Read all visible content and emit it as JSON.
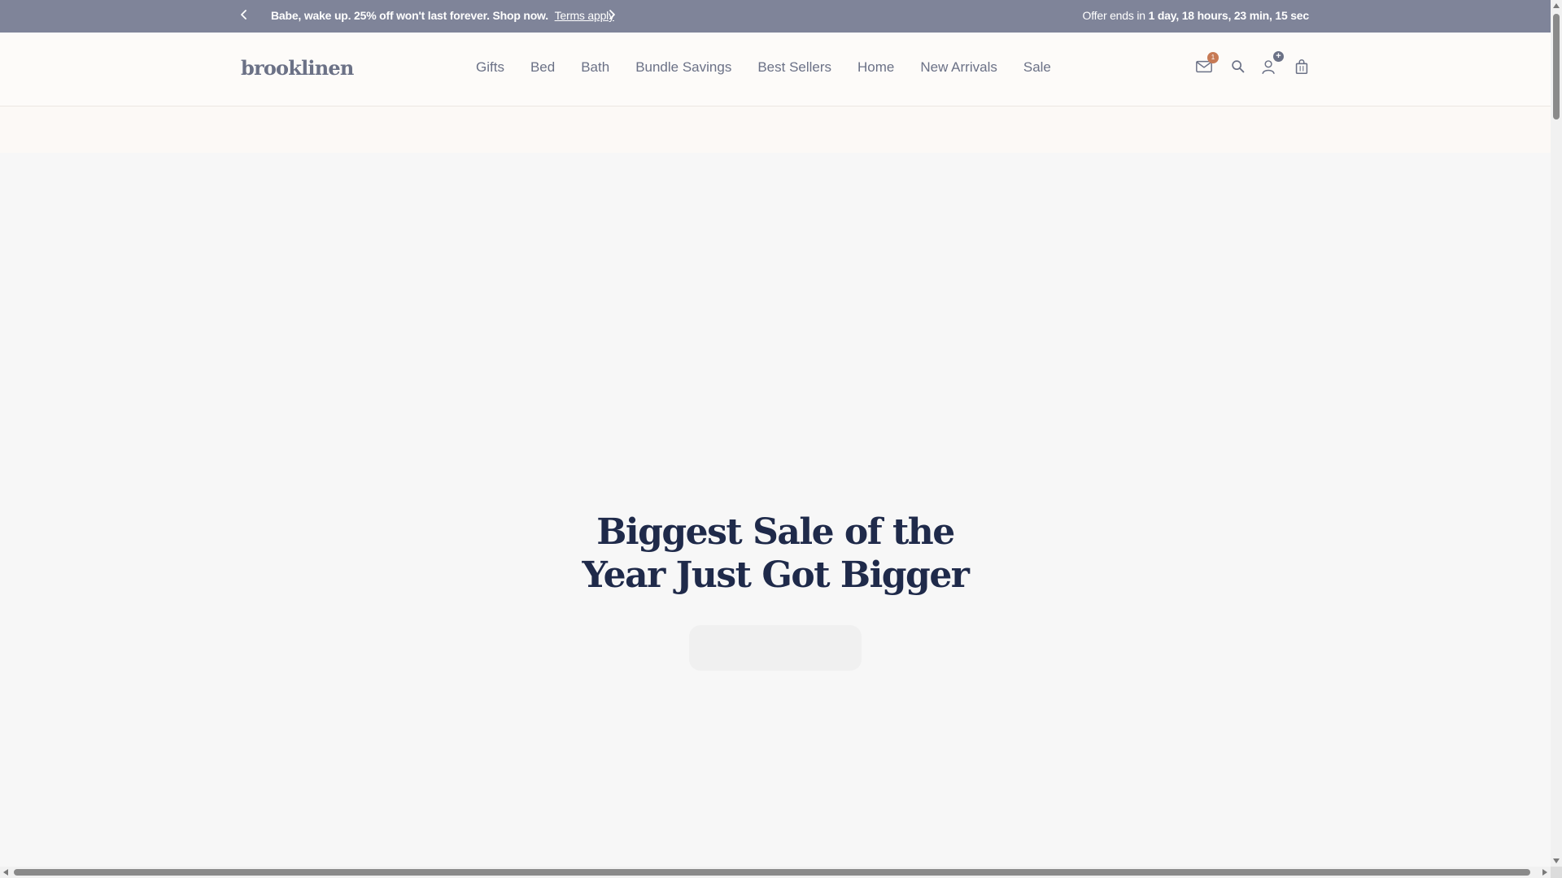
{
  "announcement": {
    "message": "Babe, wake up. 25% off won't last forever. Shop now.",
    "terms_link": "Terms apply",
    "offer_prefix": "Offer ends in",
    "countdown": "1 day, 18 hours, 23 min, 15 sec",
    "prev_icon": "chevron-left-icon",
    "next_icon": "chevron-right-icon"
  },
  "header": {
    "logo": "brooklinen",
    "nav": [
      "Gifts",
      "Bed",
      "Bath",
      "Bundle Savings",
      "Best Sellers",
      "Home",
      "New Arrivals",
      "Sale"
    ],
    "icons": {
      "mail": "mail-icon",
      "mail_badge": "1",
      "search": "search-icon",
      "account": "account-icon",
      "account_badge": "+",
      "cart": "shopping-bag-icon"
    }
  },
  "hero": {
    "headline_line1": "Biggest Sale of the",
    "headline_line2": "Year Just Got Bigger"
  },
  "colors": {
    "announcement_bg": "#7f8499",
    "headline": "#1f2a4a",
    "nav_text": "#6b7186",
    "badge": "#c77a55",
    "hero_bg": "#f7f7f7"
  }
}
